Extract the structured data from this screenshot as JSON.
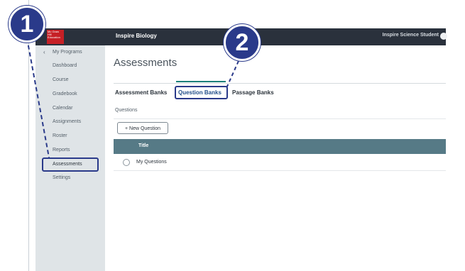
{
  "app": {
    "logo_text": "Mc Graw Hill Education",
    "title": "Inspire Biology",
    "user_name": "Inspire Science Student"
  },
  "sidebar": {
    "back_label": "My Programs",
    "items": [
      "Dashboard",
      "Course",
      "Gradebook",
      "Calendar",
      "Assignments",
      "Roster",
      "Reports",
      "Assessments",
      "Settings"
    ]
  },
  "main": {
    "page_title": "Assessments",
    "tabs": [
      "Assessment Banks",
      "Question Banks",
      "Passage Banks"
    ],
    "section_label": "Questions",
    "new_question_label": "+ New Question",
    "table": {
      "header_title": "Title",
      "rows": [
        "My Questions"
      ]
    }
  },
  "callouts": [
    "1",
    "2"
  ],
  "colors": {
    "topbar": "#2a313c",
    "sidebar": "#dfe4e7",
    "table_header": "#567a86",
    "active_tab_accent": "#1b7f7a",
    "callout": "#2a3a8a"
  }
}
